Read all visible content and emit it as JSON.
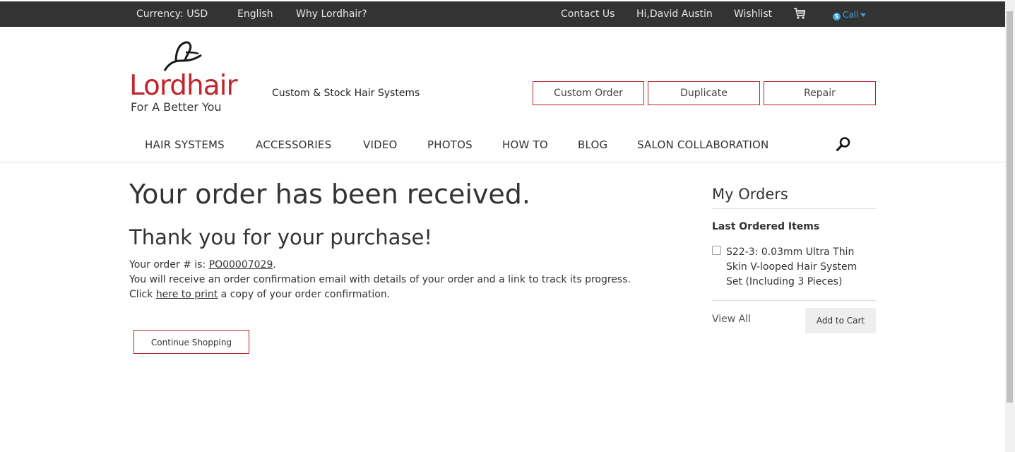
{
  "topbar": {
    "currency_label": "Currency:",
    "currency_value": "USD",
    "language": "English",
    "why": "Why Lordhair?",
    "contact": "Contact Us",
    "greeting": "Hi,David Austin",
    "wishlist": "Wishlist",
    "cart_icon": "cart-icon",
    "call_label": "Call"
  },
  "brand": {
    "name": "Lordhair",
    "tagline": "For A Better You",
    "header_tagline": "Custom & Stock Hair Systems",
    "color": "#c0262e"
  },
  "header_buttons": {
    "custom_order": "Custom Order",
    "duplicate": "Duplicate",
    "repair": "Repair"
  },
  "nav": {
    "items": [
      "HAIR SYSTEMS",
      "ACCESSORIES",
      "VIDEO",
      "PHOTOS",
      "HOW TO",
      "BLOG",
      "SALON COLLABORATION"
    ],
    "search_icon": "search-icon"
  },
  "main": {
    "heading": "Your order has been received.",
    "subheading": "Thank you for your purchase!",
    "order_prefix": "Your order # is: ",
    "order_number": "PO00007029",
    "order_suffix": ".",
    "email_line": "You will receive an order confirmation email with details of your order and a link to track its progress.",
    "print_prefix": "Click ",
    "print_link": "here to print",
    "print_suffix": " a copy of your order confirmation.",
    "continue_button": "Continue Shopping"
  },
  "sidebar": {
    "title": "My Orders",
    "subtitle": "Last Ordered Items",
    "item": "S22-3: 0.03mm Ultra Thin Skin V-looped Hair System Set (Including 3 Pieces)",
    "view_all": "View All",
    "add_to_cart": "Add to Cart"
  },
  "colors": {
    "accent": "#b5202a",
    "topbar_bg": "#333333",
    "call": "#3aa3dc"
  }
}
